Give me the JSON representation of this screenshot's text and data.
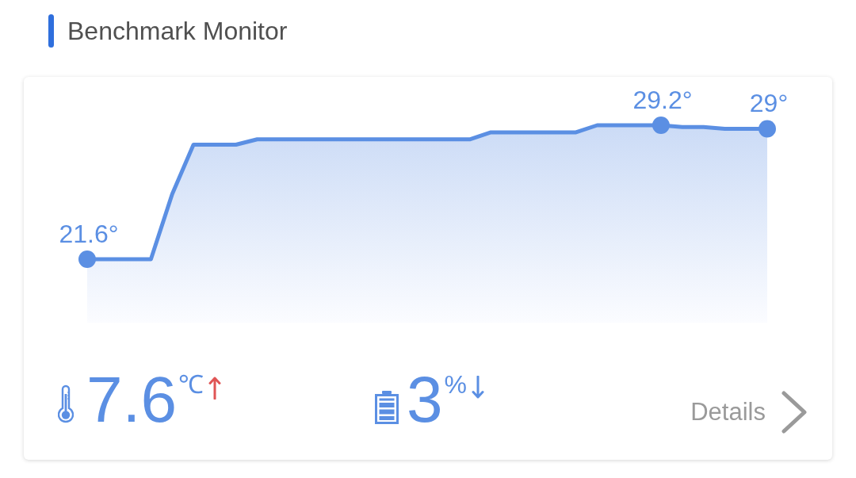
{
  "title": "Benchmark Monitor",
  "card": {
    "chart": {
      "marks": [
        {
          "kind": "start",
          "label": "21.6°"
        },
        {
          "kind": "peak",
          "label": "29.2°"
        },
        {
          "kind": "end",
          "label": "29°"
        }
      ]
    },
    "stats": [
      {
        "kind": "temperature",
        "value": "7.6",
        "unit": "℃",
        "rising": true
      },
      {
        "kind": "battery",
        "value": "3",
        "unit": "%",
        "rising": false
      }
    ],
    "details_label": "Details"
  }
}
